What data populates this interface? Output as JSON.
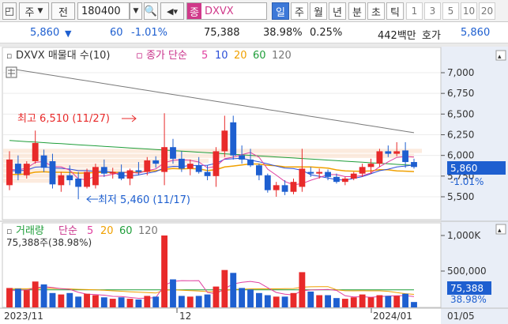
{
  "toolbar": {
    "market_label": "주",
    "period_label": "전",
    "code": "180400",
    "ticker_tag": "종",
    "ticker_name": "DXVX",
    "periods": [
      "일",
      "주",
      "월",
      "년",
      "분",
      "초",
      "틱"
    ],
    "active_period": "일",
    "numbers": [
      "1",
      "3",
      "5",
      "10",
      "20"
    ]
  },
  "quote": {
    "price": "5,860",
    "direction": "▼",
    "change": "60",
    "change_pct": "-1.01%",
    "volume": "75,388",
    "volume_ratio": "38.98%",
    "turnover": "0.25%",
    "trade_value": "442백만",
    "bid_label": "호가",
    "bid": "5,860"
  },
  "price_panel": {
    "title_icon": "▫",
    "stock_title": "DXVX 매물대 수(10)",
    "ma_prefix": "▫ 종가 단순",
    "ma_periods": [
      "5",
      "10",
      "20",
      "60",
      "120"
    ],
    "ma_colors": [
      "#e040a0",
      "#2b4fd8",
      "#f0a000",
      "#1f9e3a",
      "#777777"
    ],
    "high_label": "최고 6,510 (11/27)",
    "low_label": "최저 5,460 (11/17)",
    "y_ticks": [
      "7,000",
      "6,750",
      "6,500",
      "6,250",
      "6,000",
      "5,750",
      "5,500"
    ],
    "current_price_tag": "5,860",
    "current_pct_tag": "-1.01%"
  },
  "volume_panel": {
    "title": "거래량",
    "ma_prefix": "단순",
    "ma_periods": [
      "5",
      "20",
      "60",
      "120"
    ],
    "ma_colors": [
      "#e040a0",
      "#f0a000",
      "#1f9e3a",
      "#777777"
    ],
    "info": "75,388주(38.98%)",
    "y_ticks": [
      "1,000K",
      "500,000"
    ],
    "current_tag": "75,388",
    "current_pct": "38.98%"
  },
  "x_axis": [
    "2023/11",
    "12",
    "2024/01",
    "01/05"
  ],
  "colors": {
    "up": "#e82a2a",
    "down": "#1e5fd0",
    "accent": "#3c78d8"
  },
  "chart_data": {
    "type": "candlestick",
    "ylim": [
      5350,
      7150
    ],
    "candles": [
      {
        "o": 5640,
        "h": 6050,
        "l": 5580,
        "c": 5950
      },
      {
        "o": 5900,
        "h": 6000,
        "l": 5700,
        "c": 5780
      },
      {
        "o": 5760,
        "h": 5930,
        "l": 5720,
        "c": 5900
      },
      {
        "o": 5930,
        "h": 6300,
        "l": 5900,
        "c": 6150
      },
      {
        "o": 6000,
        "h": 6070,
        "l": 5800,
        "c": 5850
      },
      {
        "o": 5930,
        "h": 6020,
        "l": 5600,
        "c": 5650
      },
      {
        "o": 5640,
        "h": 5800,
        "l": 5560,
        "c": 5760
      },
      {
        "o": 5760,
        "h": 5880,
        "l": 5640,
        "c": 5700
      },
      {
        "o": 5720,
        "h": 5800,
        "l": 5470,
        "c": 5620
      },
      {
        "o": 5620,
        "h": 5840,
        "l": 5600,
        "c": 5800
      },
      {
        "o": 5640,
        "h": 5900,
        "l": 5600,
        "c": 5860
      },
      {
        "o": 5860,
        "h": 5950,
        "l": 5740,
        "c": 5780
      },
      {
        "o": 5780,
        "h": 5850,
        "l": 5720,
        "c": 5800
      },
      {
        "o": 5800,
        "h": 5890,
        "l": 5700,
        "c": 5720
      },
      {
        "o": 5720,
        "h": 5840,
        "l": 5640,
        "c": 5820
      },
      {
        "o": 5820,
        "h": 5920,
        "l": 5760,
        "c": 5800
      },
      {
        "o": 5800,
        "h": 5980,
        "l": 5760,
        "c": 5940
      },
      {
        "o": 5940,
        "h": 5990,
        "l": 5850,
        "c": 5900
      },
      {
        "o": 5800,
        "h": 6510,
        "l": 5640,
        "c": 6100
      },
      {
        "o": 6100,
        "h": 6200,
        "l": 5900,
        "c": 5960
      },
      {
        "o": 5960,
        "h": 6050,
        "l": 5800,
        "c": 5840
      },
      {
        "o": 5840,
        "h": 5950,
        "l": 5760,
        "c": 5900
      },
      {
        "o": 5880,
        "h": 5980,
        "l": 5780,
        "c": 5800
      },
      {
        "o": 5800,
        "h": 5880,
        "l": 5700,
        "c": 5750
      },
      {
        "o": 5750,
        "h": 6100,
        "l": 5620,
        "c": 6050
      },
      {
        "o": 6050,
        "h": 6480,
        "l": 5980,
        "c": 6300
      },
      {
        "o": 6400,
        "h": 6480,
        "l": 5950,
        "c": 6000
      },
      {
        "o": 6000,
        "h": 6120,
        "l": 5900,
        "c": 5950
      },
      {
        "o": 5950,
        "h": 6080,
        "l": 5860,
        "c": 5880
      },
      {
        "o": 5880,
        "h": 5900,
        "l": 5700,
        "c": 5760
      },
      {
        "o": 5760,
        "h": 5780,
        "l": 5550,
        "c": 5580
      },
      {
        "o": 5580,
        "h": 5680,
        "l": 5500,
        "c": 5640
      },
      {
        "o": 5640,
        "h": 5700,
        "l": 5520,
        "c": 5560
      },
      {
        "o": 5560,
        "h": 5720,
        "l": 5530,
        "c": 5680
      },
      {
        "o": 5620,
        "h": 6080,
        "l": 5560,
        "c": 5840
      },
      {
        "o": 5800,
        "h": 5860,
        "l": 5740,
        "c": 5780
      },
      {
        "o": 5780,
        "h": 5840,
        "l": 5720,
        "c": 5800
      },
      {
        "o": 5800,
        "h": 5830,
        "l": 5700,
        "c": 5740
      },
      {
        "o": 5740,
        "h": 5780,
        "l": 5660,
        "c": 5680
      },
      {
        "o": 5680,
        "h": 5740,
        "l": 5640,
        "c": 5720
      },
      {
        "o": 5720,
        "h": 5800,
        "l": 5700,
        "c": 5780
      },
      {
        "o": 5780,
        "h": 5900,
        "l": 5740,
        "c": 5860
      },
      {
        "o": 5860,
        "h": 5960,
        "l": 5780,
        "c": 5900
      },
      {
        "o": 5900,
        "h": 6080,
        "l": 5860,
        "c": 6050
      },
      {
        "o": 6050,
        "h": 6120,
        "l": 5980,
        "c": 6020
      },
      {
        "o": 6020,
        "h": 6160,
        "l": 5990,
        "c": 6050
      },
      {
        "o": 6060,
        "h": 6160,
        "l": 5850,
        "c": 5920
      },
      {
        "o": 5920,
        "h": 5960,
        "l": 5840,
        "c": 5860
      }
    ],
    "volumes": [
      270,
      260,
      240,
      360,
      320,
      200,
      180,
      200,
      150,
      190,
      170,
      140,
      120,
      140,
      120,
      110,
      160,
      150,
      1000,
      390,
      160,
      150,
      160,
      180,
      290,
      520,
      480,
      270,
      250,
      200,
      170,
      150,
      150,
      200,
      490,
      220,
      170,
      170,
      130,
      120,
      140,
      180,
      140,
      170,
      160,
      160,
      190,
      75
    ],
    "vol_ylim": [
      0,
      1150
    ]
  }
}
